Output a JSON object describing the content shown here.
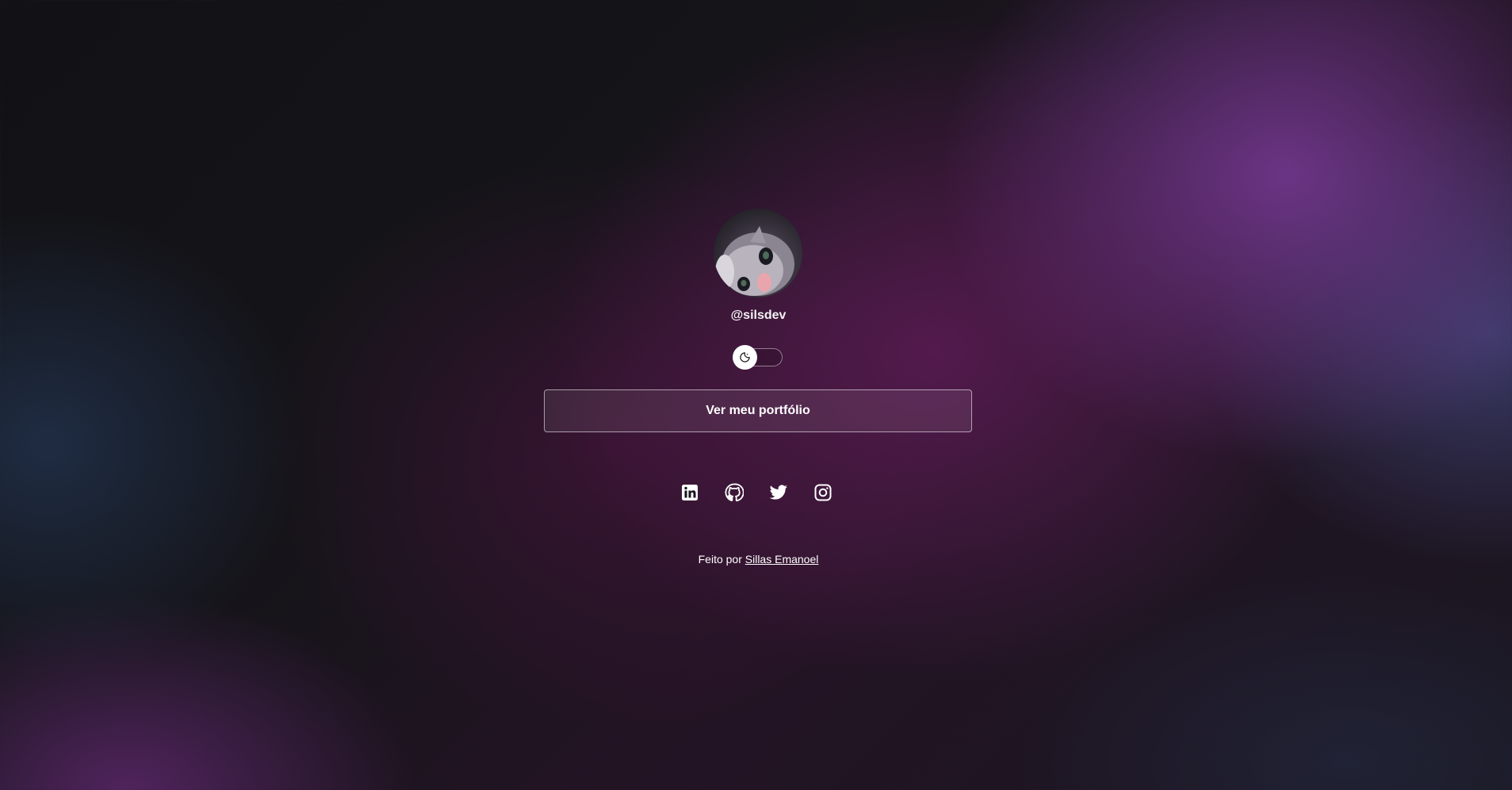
{
  "profile": {
    "avatar_alt": "avatar",
    "username": "@silsdev"
  },
  "theme_toggle": {
    "icon": "moon-icon",
    "state": "off"
  },
  "portfolio_button": {
    "label": "Ver meu portfólio"
  },
  "socials": [
    {
      "name": "linkedin",
      "icon": "linkedin-icon"
    },
    {
      "name": "github",
      "icon": "github-icon"
    },
    {
      "name": "twitter",
      "icon": "twitter-icon"
    },
    {
      "name": "instagram",
      "icon": "instagram-icon"
    }
  ],
  "footer": {
    "prefix": "Feito por",
    "author": "Sillas Emanoel"
  },
  "colors": {
    "text": "#ffffff",
    "accent_purple": "#783a96",
    "background_dark": "#121216"
  }
}
